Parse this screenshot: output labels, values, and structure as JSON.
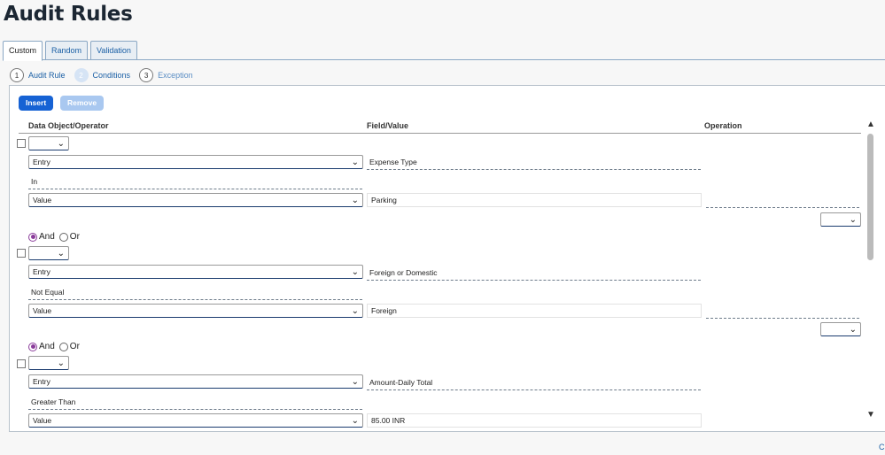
{
  "page": {
    "title": "Audit Rules"
  },
  "tabs": [
    {
      "label": "Custom",
      "active": true
    },
    {
      "label": "Random",
      "active": false
    },
    {
      "label": "Validation",
      "active": false
    }
  ],
  "steps": [
    {
      "num": "1",
      "label": "Audit Rule"
    },
    {
      "num": "2",
      "label": "Conditions"
    },
    {
      "num": "3",
      "label": "Exception"
    }
  ],
  "toolbar": {
    "insert_label": "Insert",
    "remove_label": "Remove"
  },
  "headers": {
    "data_object": "Data Object/Operator",
    "field_value": "Field/Value",
    "operation": "Operation"
  },
  "conjunction": {
    "and": "And",
    "or": "Or"
  },
  "conditions": [
    {
      "entry": "Entry",
      "field": "Expense Type",
      "operator": "In",
      "value_type": "Value",
      "value": "Parking"
    },
    {
      "entry": "Entry",
      "field": "Foreign or Domestic",
      "operator": "Not Equal",
      "value_type": "Value",
      "value": "Foreign"
    },
    {
      "entry": "Entry",
      "field": "Amount-Daily Total",
      "operator": "Greater Than",
      "value_type": "Value",
      "value": "85.00 INR"
    }
  ],
  "corner_text": "C",
  "colors": {
    "primary": "#1662d4",
    "link": "#1a5fa5",
    "radio": "#8a3c9a"
  }
}
